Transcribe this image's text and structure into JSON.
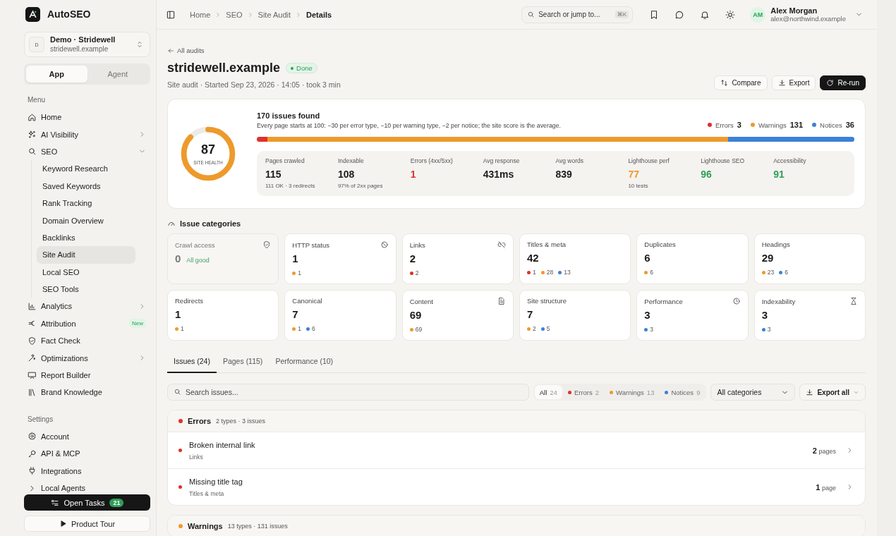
{
  "sidebar": {
    "brand": "AutoSEO",
    "workspace": {
      "initial": "D",
      "name": "Demo · Stridewell",
      "domain": "stridewell.example"
    },
    "modes": [
      {
        "label": "App",
        "selected": true
      },
      {
        "label": "Agent",
        "selected": false
      }
    ],
    "sections": [
      {
        "heading": "Menu",
        "items": [
          {
            "label": "Home",
            "selected": false
          },
          {
            "label": "AI Visibility",
            "selected": false,
            "expanded": false
          },
          {
            "label": "SEO",
            "selected": false,
            "expanded": true,
            "children": [
              {
                "label": "Keyword Research",
                "selected": false
              },
              {
                "label": "Saved Keywords",
                "selected": false
              },
              {
                "label": "Rank Tracking",
                "selected": false
              },
              {
                "label": "Domain Overview",
                "selected": false
              },
              {
                "label": "Backlinks",
                "selected": false
              },
              {
                "label": "Site Audit",
                "selected": true
              },
              {
                "label": "Local SEO",
                "selected": false
              },
              {
                "label": "SEO Tools",
                "selected": false
              }
            ]
          },
          {
            "label": "Analytics",
            "selected": false,
            "expanded": false
          },
          {
            "label": "Attribution",
            "selected": false,
            "badge": "New"
          },
          {
            "label": "Fact Check",
            "selected": false
          },
          {
            "label": "Optimizations",
            "selected": false,
            "expanded": false
          },
          {
            "label": "Report Builder",
            "selected": false
          },
          {
            "label": "Brand Knowledge",
            "selected": false
          }
        ]
      },
      {
        "heading": "Settings",
        "items": [
          {
            "label": "Account",
            "selected": false
          },
          {
            "label": "API & MCP",
            "selected": false
          },
          {
            "label": "Integrations",
            "selected": false
          },
          {
            "label": "Local Agents",
            "selected": false,
            "expanded": false
          }
        ]
      }
    ],
    "tasks": {
      "label": "Open Tasks",
      "count": "21"
    },
    "tour": {
      "label": "Product Tour"
    }
  },
  "header": {
    "breadcrumbs": [
      "Home",
      "SEO",
      "Site Audit",
      "Details"
    ],
    "search": {
      "placeholder": "Search or jump to...",
      "shortcut": "⌘K"
    },
    "user": {
      "initials": "AM",
      "name": "Alex Morgan",
      "email": "alex@northwind.example"
    }
  },
  "page": {
    "back": "All audits",
    "title": "stridewell.example",
    "status": "Done",
    "subtitle": "Site audit · Started Sep 23, 2026 · 14:05 · took 3 min",
    "actions": [
      {
        "label": "Compare",
        "kind": "compare"
      },
      {
        "label": "Export",
        "kind": "export"
      },
      {
        "label": "Re-run",
        "kind": "rerun"
      }
    ]
  },
  "summary": {
    "score": "87",
    "score_label": "SITE HEALTH",
    "level": 0.87,
    "heading": "170 issues found",
    "description": "Every page starts at 100: −30 per error type, −10 per warning type, −2 per notice; the site score is the average.",
    "legend": [
      {
        "label": "Errors",
        "count": "3",
        "color": "#e0302c"
      },
      {
        "label": "Warnings",
        "count": "131",
        "color": "#ee9a2b"
      },
      {
        "label": "Notices",
        "count": "36",
        "color": "#3a82d8"
      }
    ],
    "stats": [
      {
        "label": "Pages crawled",
        "value": "115",
        "note": "111 OK · 3 redirects"
      },
      {
        "label": "Indexable",
        "value": "108",
        "note": "97% of 2xx pages"
      },
      {
        "label": "Errors (4xx/5xx)",
        "value": "1",
        "color": "#e0302c"
      },
      {
        "label": "Avg response",
        "value": "431ms"
      },
      {
        "label": "Avg words",
        "value": "839"
      },
      {
        "label": "Lighthouse perf",
        "value": "77",
        "note": "10 tests",
        "color": "#ee9a2b"
      },
      {
        "label": "Lighthouse SEO",
        "value": "96",
        "color": "#2f9e57"
      },
      {
        "label": "Accessibility",
        "value": "91",
        "color": "#2f9e57"
      }
    ]
  },
  "categories": {
    "heading": "Issue categories",
    "items": [
      {
        "name": "Crawl access",
        "count": "0",
        "note": "All good",
        "muted": true
      },
      {
        "name": "HTTP status",
        "count": "1",
        "dots": [
          {
            "color": "#ee9a2b",
            "count": "1"
          }
        ]
      },
      {
        "name": "Links",
        "count": "2",
        "dots": [
          {
            "color": "#e0302c",
            "count": "2"
          }
        ]
      },
      {
        "name": "Titles & meta",
        "count": "42",
        "dots": [
          {
            "color": "#e0302c",
            "count": "1"
          },
          {
            "color": "#ee9a2b",
            "count": "28"
          },
          {
            "color": "#3a82d8",
            "count": "13"
          }
        ]
      },
      {
        "name": "Duplicates",
        "count": "6",
        "dots": [
          {
            "color": "#ee9a2b",
            "count": "6"
          }
        ]
      },
      {
        "name": "Headings",
        "count": "29",
        "dots": [
          {
            "color": "#ee9a2b",
            "count": "23"
          },
          {
            "color": "#3a82d8",
            "count": "6"
          }
        ]
      },
      {
        "name": "Redirects",
        "count": "1",
        "dots": [
          {
            "color": "#ee9a2b",
            "count": "1"
          }
        ]
      },
      {
        "name": "Canonical",
        "count": "7",
        "dots": [
          {
            "color": "#ee9a2b",
            "count": "1"
          },
          {
            "color": "#3a82d8",
            "count": "6"
          }
        ]
      },
      {
        "name": "Content",
        "count": "69",
        "dots": [
          {
            "color": "#ee9a2b",
            "count": "69"
          }
        ]
      },
      {
        "name": "Site structure",
        "count": "7",
        "dots": [
          {
            "color": "#ee9a2b",
            "count": "2"
          },
          {
            "color": "#3a82d8",
            "count": "5"
          }
        ]
      },
      {
        "name": "Performance",
        "count": "3",
        "dots": [
          {
            "color": "#3a82d8",
            "count": "3"
          }
        ]
      },
      {
        "name": "Indexability",
        "count": "3",
        "dots": [
          {
            "color": "#3a82d8",
            "count": "3"
          }
        ]
      }
    ]
  },
  "tabs": [
    {
      "label": "Issues (24)",
      "selected": true
    },
    {
      "label": "Pages (115)",
      "selected": false
    },
    {
      "label": "Performance (10)",
      "selected": false
    }
  ],
  "filters": {
    "search_placeholder": "Search issues...",
    "chips": [
      {
        "label": "All",
        "count": "24",
        "selected": true
      },
      {
        "label": "Errors",
        "count": "2",
        "color": "#e0302c",
        "selected": false
      },
      {
        "label": "Warnings",
        "count": "13",
        "color": "#ee9a2b",
        "selected": false
      },
      {
        "label": "Notices",
        "count": "9",
        "color": "#3a82d8",
        "selected": false
      }
    ],
    "category_select": "All categories",
    "export": "Export all"
  },
  "groups": [
    {
      "title": "Errors",
      "meta": "2 types · 3 issues",
      "color": "#e0302c",
      "issues": [
        {
          "title": "Broken internal link",
          "category": "Links",
          "count": "2",
          "unit": "pages"
        },
        {
          "title": "Missing title tag",
          "category": "Titles & meta",
          "count": "1",
          "unit": "page"
        }
      ]
    },
    {
      "title": "Warnings",
      "meta": "13 types · 131 issues",
      "color": "#ee9a2b"
    }
  ]
}
